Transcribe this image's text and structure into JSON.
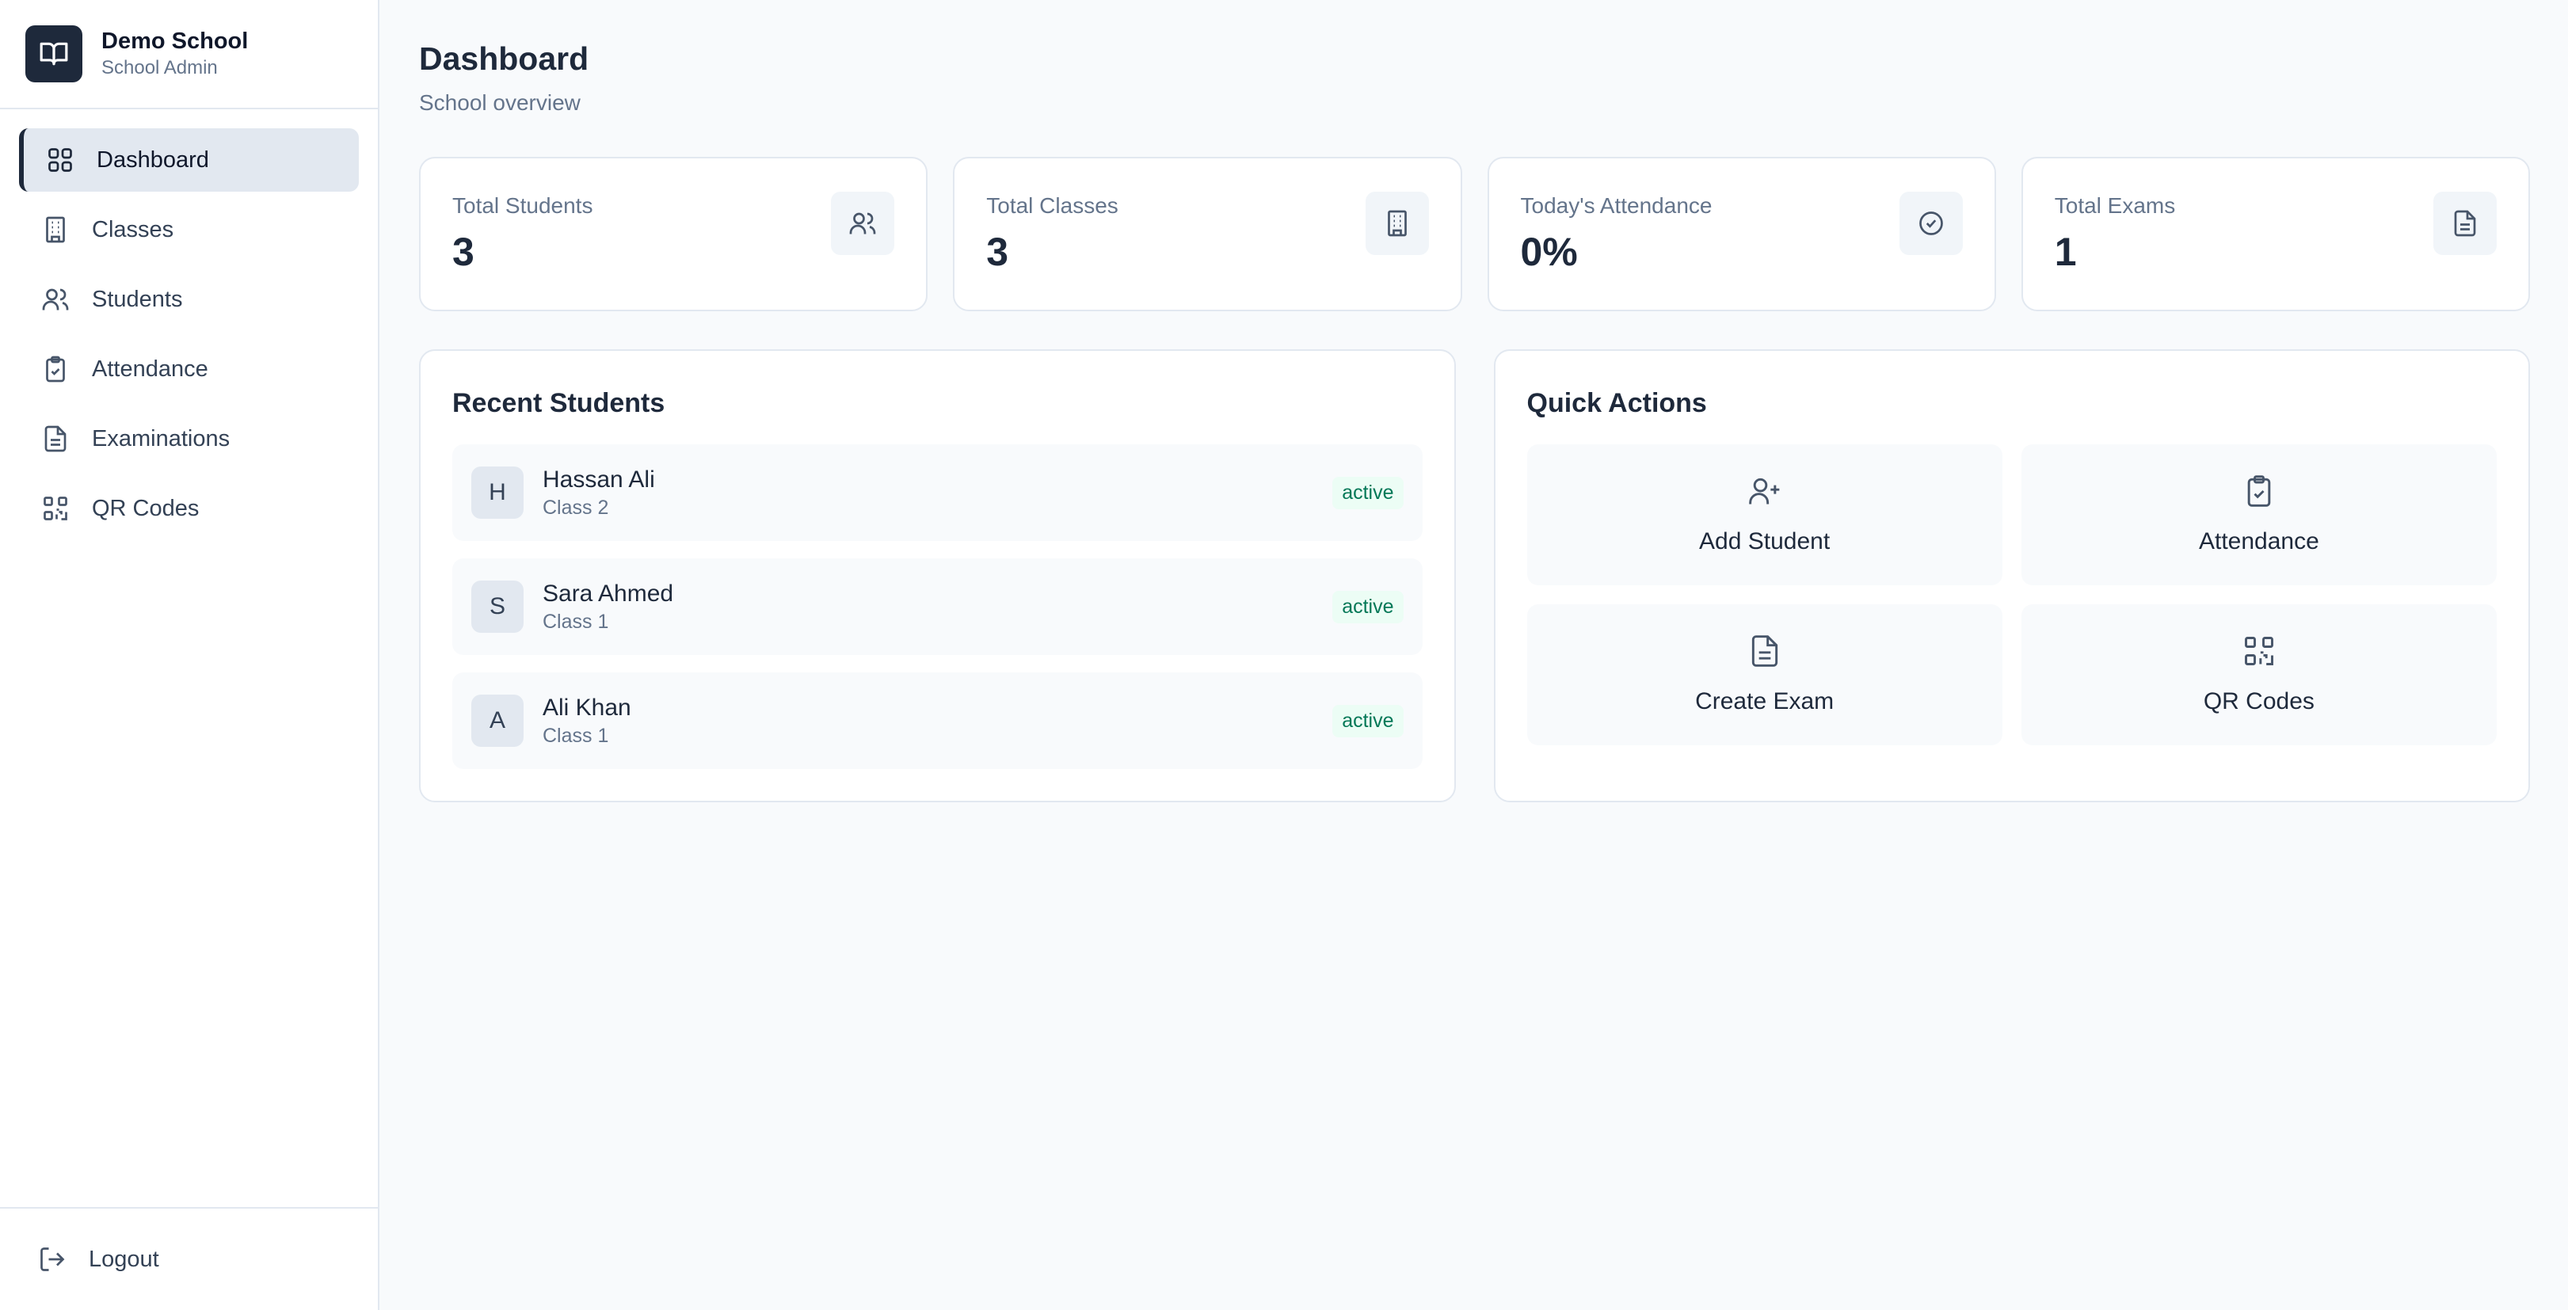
{
  "brand": {
    "name": "Demo School",
    "role": "School Admin"
  },
  "nav": {
    "items": [
      {
        "label": "Dashboard",
        "icon": "dashboard-grid-icon",
        "active": true
      },
      {
        "label": "Classes",
        "icon": "building-icon"
      },
      {
        "label": "Students",
        "icon": "users-icon"
      },
      {
        "label": "Attendance",
        "icon": "clipboard-check-icon"
      },
      {
        "label": "Examinations",
        "icon": "file-text-icon"
      },
      {
        "label": "QR Codes",
        "icon": "qr-code-icon"
      }
    ],
    "logout": "Logout"
  },
  "page": {
    "title": "Dashboard",
    "subtitle": "School overview"
  },
  "stats": [
    {
      "label": "Total Students",
      "value": "3",
      "icon": "users-icon"
    },
    {
      "label": "Total Classes",
      "value": "3",
      "icon": "building-icon"
    },
    {
      "label": "Today's Attendance",
      "value": "0%",
      "icon": "check-circle-icon"
    },
    {
      "label": "Total Exams",
      "value": "1",
      "icon": "file-text-icon"
    }
  ],
  "recent_students": {
    "title": "Recent Students",
    "items": [
      {
        "initial": "H",
        "name": "Hassan Ali",
        "class": "Class 2",
        "status": "active"
      },
      {
        "initial": "S",
        "name": "Sara Ahmed",
        "class": "Class 1",
        "status": "active"
      },
      {
        "initial": "A",
        "name": "Ali Khan",
        "class": "Class 1",
        "status": "active"
      }
    ]
  },
  "quick_actions": {
    "title": "Quick Actions",
    "items": [
      {
        "label": "Add Student",
        "icon": "user-plus-icon"
      },
      {
        "label": "Attendance",
        "icon": "clipboard-check-icon"
      },
      {
        "label": "Create Exam",
        "icon": "file-text-icon"
      },
      {
        "label": "QR Codes",
        "icon": "qr-code-icon"
      }
    ]
  },
  "colors": {
    "accent": "#1e293b",
    "active_badge": "#047857",
    "active_badge_bg": "#ecfdf5"
  }
}
